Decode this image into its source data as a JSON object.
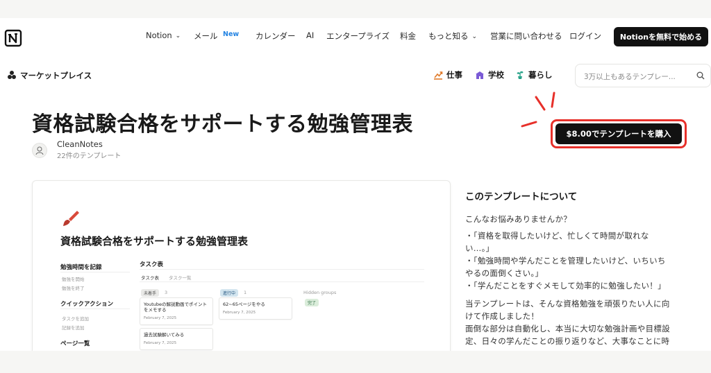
{
  "nav": {
    "items": [
      {
        "label": "Notion",
        "chevron": true
      },
      {
        "label": "メール",
        "chevron": false
      },
      {
        "label": "カレンダー",
        "chevron": false
      },
      {
        "label": "AI",
        "chevron": false
      },
      {
        "label": "エンタープライズ",
        "chevron": false
      },
      {
        "label": "料金",
        "chevron": false
      },
      {
        "label": "もっと知る",
        "chevron": true
      },
      {
        "label": "営業に問い合わせる",
        "chevron": false
      },
      {
        "label": "ログイン",
        "chevron": false
      }
    ],
    "new_badge": "New",
    "cta": "Notionを無料で始める"
  },
  "marketplace": {
    "label": "マーケットプレイス",
    "categories": [
      {
        "label": "仕事",
        "icon": "chart-icon",
        "color": "#e07a2a"
      },
      {
        "label": "学校",
        "icon": "school-icon",
        "color": "#7b5bd6"
      },
      {
        "label": "暮らし",
        "icon": "plant-icon",
        "color": "#2aa38a"
      }
    ],
    "search_placeholder": "3万以上もあるテンプレー..."
  },
  "template": {
    "title": "資格試験合格をサポートする勉強管理表",
    "author": "CleanNotes",
    "author_sub": "22件のテンプレート",
    "buy_label": "$8.00でテンプレートを購入",
    "accent": "#e7302a"
  },
  "preview": {
    "title": "資格試験合格をサポートする勉強管理表",
    "left": {
      "heading1": "勉強時間を記録",
      "items1": [
        "勉強を開始",
        "勉強を終了"
      ],
      "heading2": "クイックアクション",
      "items2": [
        "タスクを追加",
        "記録を追加"
      ],
      "heading3": "ページ一覧"
    },
    "board": {
      "heading": "タスク表",
      "tabs": [
        "タスク表",
        "タスク一覧"
      ],
      "columns": [
        {
          "label": "未着手",
          "count": "3",
          "color": "#e9e9e7"
        },
        {
          "label": "進行中",
          "count": "1",
          "color": "#d3e5ef"
        },
        {
          "label": "Hidden groups",
          "count": "",
          "color": ""
        }
      ],
      "done_pill": "完了",
      "cards": [
        {
          "title": "Youtubeの解説動画でポイントをメモする",
          "date": "February 7, 2025"
        },
        {
          "title": "62~65ページをやる",
          "date": "February 7, 2025"
        },
        {
          "title": "過去試験解いてみる",
          "date": "February 7, 2025"
        }
      ]
    }
  },
  "about": {
    "heading": "このテンプレートについて",
    "lines": [
      "こんなお悩みありませんか？",
      "・「資格を取得したいけど、忙しくて時間が取れな",
      "い…。」",
      "・「勉強時間や学んだことを管理したいけど、いちいち",
      "やるの面倒くさい。」",
      "・「学んだことをすぐメモして効率的に勉強したい！」",
      "当テンプレートは、そんな資格勉強を頑張りたい人に向",
      "けて作成しました！",
      "面倒な部分は自動化し、本当に大切な勉強計画や目標設",
      "定、日々の学んだことの振り返りなど、大事なことに時"
    ]
  }
}
